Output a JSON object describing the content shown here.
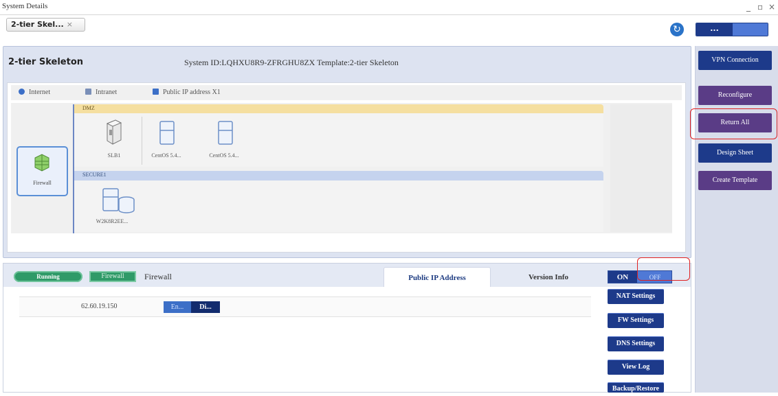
{
  "window": {
    "title": "System Details",
    "controls": [
      "_",
      "▫",
      "×"
    ]
  },
  "tabs": {
    "active": "2-tier Skel...",
    "close_glyph": "×"
  },
  "view_toggle": {
    "on": "...",
    "off": ""
  },
  "system": {
    "name": "2-tier Skeleton",
    "info": "System ID:LQHXU8R9-ZFRGHU8ZX  Template:2-tier Skeleton"
  },
  "legend": [
    {
      "label": "Internet",
      "color": "#3c6fc7"
    },
    {
      "label": "Intranet",
      "color": "#7a8fb8"
    },
    {
      "label": "Public IP address X1",
      "color": "#3c6fc7"
    }
  ],
  "firewall": {
    "label": "Firewall"
  },
  "zones": {
    "dmz": {
      "label": "DMZ",
      "servers": [
        "SLB1",
        "CentOS 5.4...",
        "CentOS 5.4..."
      ]
    },
    "secure": {
      "label": "SECURE1",
      "servers": [
        "W2K8R2EE..."
      ]
    }
  },
  "bottom": {
    "status": "Running",
    "type_badge": "Firewall",
    "name": "Firewall",
    "tabs": [
      "Public IP Address",
      "Version Info"
    ],
    "ip_rows": [
      {
        "ip": "62.60.19.150",
        "enable": "En...",
        "disable": "Di..."
      }
    ]
  },
  "power": {
    "on": "ON",
    "off": "OFF"
  },
  "actions": [
    "NAT Settings",
    "FW Settings",
    "DNS Settings",
    "View Log",
    "Backup/Restore"
  ],
  "sidebar": [
    "VPN Connection",
    "Reconfigure",
    "Return All",
    "Design Sheet",
    "Create Template"
  ],
  "colors": {
    "accent": "#1d3a8a",
    "running": "#2f9a68",
    "dmz": "#f5dfa0",
    "secure": "#c5d3ee",
    "highlight": "#e02020"
  }
}
